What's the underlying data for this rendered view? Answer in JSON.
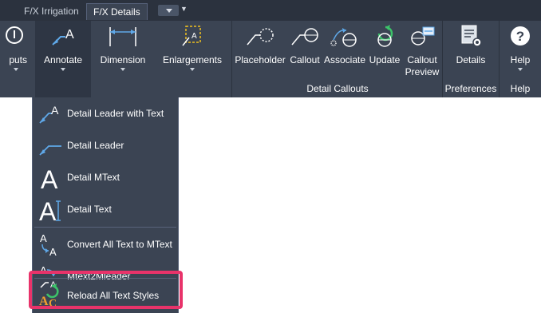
{
  "tabs": [
    {
      "label": "F/X Irrigation",
      "active": false
    },
    {
      "label": "F/X Details",
      "active": true
    }
  ],
  "ribbon": {
    "buttons": {
      "outputs": "puts",
      "annotate": "Annotate",
      "dimension": "Dimension",
      "enlargements": "Enlargements",
      "placeholder": "Placeholder",
      "callout": "Callout",
      "associate": "Associate",
      "update": "Update",
      "callout_preview_line1": "Callout",
      "callout_preview_line2": "Preview",
      "details": "Details",
      "help": "Help"
    },
    "groups": {
      "detail_callouts": "Detail Callouts",
      "preferences": "Preferences",
      "help": "Help"
    }
  },
  "annotate_menu": {
    "items": [
      {
        "label": "Detail Leader with Text",
        "icon": "leader-text-icon"
      },
      {
        "label": "Detail Leader",
        "icon": "leader-icon"
      },
      {
        "label": "Detail MText",
        "icon": "mtext-icon"
      },
      {
        "label": "Detail Text",
        "icon": "text-icon"
      },
      {
        "label": "Convert All Text to MText",
        "icon": "convert-text-icon"
      },
      {
        "label": "Mtext2Mleader",
        "icon": "mtext-to-mleader-icon"
      },
      {
        "label": "Reload All Text Styles",
        "icon": "reload-styles-icon",
        "highlighted": true
      }
    ]
  },
  "colors": {
    "ribbon_bg": "#3b4453",
    "tabbar_bg": "#2b323e",
    "highlight": "#e8336a",
    "icon_blue": "#5fa8e8",
    "icon_green": "#3cc46a",
    "icon_orange": "#f0a030"
  }
}
